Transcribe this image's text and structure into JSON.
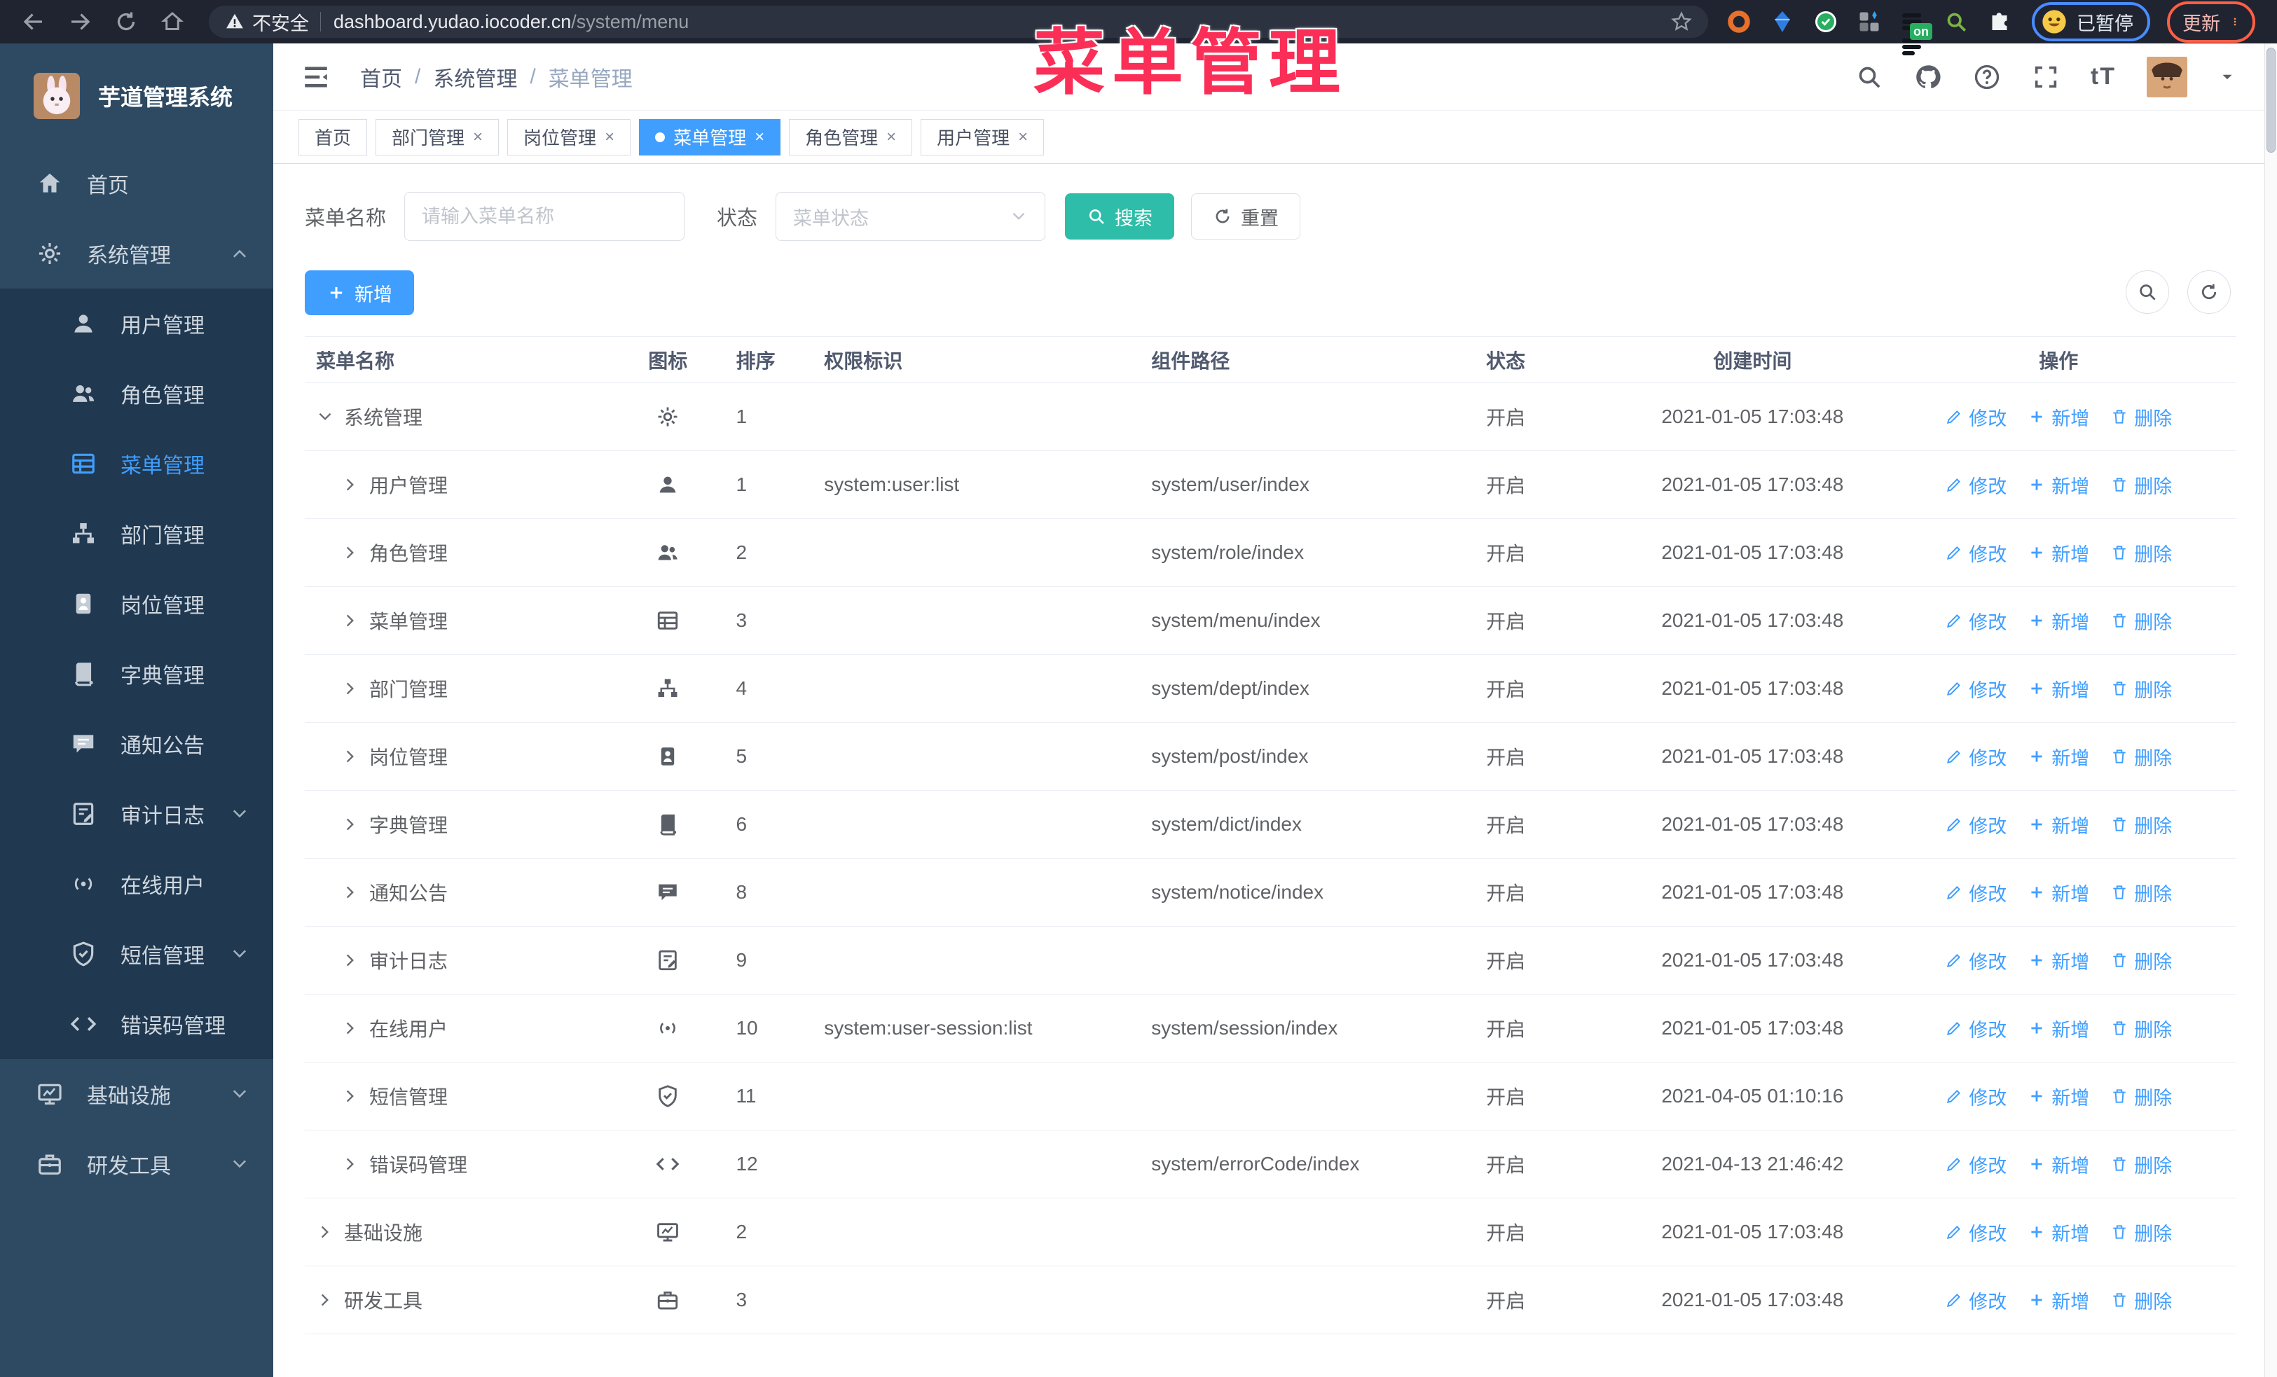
{
  "colors": {
    "accent": "#409eff",
    "search_btn": "#2dbda8",
    "annotation": "#fb2e57",
    "sidebar_bg": "#2e4a63",
    "submenu_bg": "#203850",
    "chrome_bg": "#1f2430"
  },
  "annotation": {
    "title": "菜单管理"
  },
  "browser": {
    "security_label": "不安全",
    "url_host": "dashboard.yudao.iocoder.cn",
    "url_path": "/system/menu",
    "extension_badge": "on",
    "paused_label": "已暂停",
    "update_label": "更新"
  },
  "app": {
    "title": "芋道管理系统"
  },
  "breadcrumb": {
    "items": [
      "首页",
      "系统管理",
      "菜单管理"
    ],
    "separator": "/"
  },
  "header_icons": {
    "text_size": "tT"
  },
  "tabs": [
    {
      "label": "首页",
      "closable": false,
      "active": false
    },
    {
      "label": "部门管理",
      "closable": true,
      "active": false
    },
    {
      "label": "岗位管理",
      "closable": true,
      "active": false
    },
    {
      "label": "菜单管理",
      "closable": true,
      "active": true
    },
    {
      "label": "角色管理",
      "closable": true,
      "active": false
    },
    {
      "label": "用户管理",
      "closable": true,
      "active": false
    }
  ],
  "sidebar": {
    "items": [
      {
        "label": "首页",
        "icon": "home"
      },
      {
        "label": "系统管理",
        "icon": "gear",
        "chevron": "up",
        "open": true,
        "children": [
          {
            "label": "用户管理",
            "icon": "user"
          },
          {
            "label": "角色管理",
            "icon": "users"
          },
          {
            "label": "菜单管理",
            "icon": "menu",
            "active": true
          },
          {
            "label": "部门管理",
            "icon": "tree"
          },
          {
            "label": "岗位管理",
            "icon": "post"
          },
          {
            "label": "字典管理",
            "icon": "dict"
          },
          {
            "label": "通知公告",
            "icon": "notice"
          },
          {
            "label": "审计日志",
            "icon": "log",
            "chevron": "down"
          },
          {
            "label": "在线用户",
            "icon": "online"
          },
          {
            "label": "短信管理",
            "icon": "shield",
            "chevron": "down"
          },
          {
            "label": "错误码管理",
            "icon": "code"
          }
        ]
      },
      {
        "label": "基础设施",
        "icon": "monitor",
        "chevron": "down"
      },
      {
        "label": "研发工具",
        "icon": "tool",
        "chevron": "down"
      }
    ]
  },
  "filters": {
    "name_label": "菜单名称",
    "name_placeholder": "请输入菜单名称",
    "status_label": "状态",
    "status_placeholder": "菜单状态",
    "search_label": "搜索",
    "reset_label": "重置"
  },
  "toolbar": {
    "add_label": "新增"
  },
  "table": {
    "columns": [
      "菜单名称",
      "图标",
      "排序",
      "权限标识",
      "组件路径",
      "状态",
      "创建时间",
      "操作"
    ],
    "actions": [
      {
        "label": "修改",
        "icon": "edit"
      },
      {
        "label": "新增",
        "icon": "plus"
      },
      {
        "label": "删除",
        "icon": "trash"
      }
    ],
    "rows": [
      {
        "name": "系统管理",
        "icon": "gear",
        "level": 0,
        "expanded": true,
        "order": "1",
        "perm": "",
        "path": "",
        "status": "开启",
        "time": "2021-01-05 17:03:48"
      },
      {
        "name": "用户管理",
        "icon": "user",
        "level": 1,
        "expanded": false,
        "order": "1",
        "perm": "system:user:list",
        "path": "system/user/index",
        "status": "开启",
        "time": "2021-01-05 17:03:48"
      },
      {
        "name": "角色管理",
        "icon": "users",
        "level": 1,
        "expanded": false,
        "order": "2",
        "perm": "",
        "path": "system/role/index",
        "status": "开启",
        "time": "2021-01-05 17:03:48"
      },
      {
        "name": "菜单管理",
        "icon": "menu",
        "level": 1,
        "expanded": false,
        "order": "3",
        "perm": "",
        "path": "system/menu/index",
        "status": "开启",
        "time": "2021-01-05 17:03:48"
      },
      {
        "name": "部门管理",
        "icon": "tree",
        "level": 1,
        "expanded": false,
        "order": "4",
        "perm": "",
        "path": "system/dept/index",
        "status": "开启",
        "time": "2021-01-05 17:03:48"
      },
      {
        "name": "岗位管理",
        "icon": "post",
        "level": 1,
        "expanded": false,
        "order": "5",
        "perm": "",
        "path": "system/post/index",
        "status": "开启",
        "time": "2021-01-05 17:03:48"
      },
      {
        "name": "字典管理",
        "icon": "dict",
        "level": 1,
        "expanded": false,
        "order": "6",
        "perm": "",
        "path": "system/dict/index",
        "status": "开启",
        "time": "2021-01-05 17:03:48"
      },
      {
        "name": "通知公告",
        "icon": "notice",
        "level": 1,
        "expanded": false,
        "order": "8",
        "perm": "",
        "path": "system/notice/index",
        "status": "开启",
        "time": "2021-01-05 17:03:48"
      },
      {
        "name": "审计日志",
        "icon": "log",
        "level": 1,
        "expanded": false,
        "order": "9",
        "perm": "",
        "path": "",
        "status": "开启",
        "time": "2021-01-05 17:03:48"
      },
      {
        "name": "在线用户",
        "icon": "online",
        "level": 1,
        "expanded": false,
        "order": "10",
        "perm": "system:user-session:list",
        "path": "system/session/index",
        "status": "开启",
        "time": "2021-01-05 17:03:48"
      },
      {
        "name": "短信管理",
        "icon": "shield",
        "level": 1,
        "expanded": false,
        "order": "11",
        "perm": "",
        "path": "",
        "status": "开启",
        "time": "2021-04-05 01:10:16"
      },
      {
        "name": "错误码管理",
        "icon": "code",
        "level": 1,
        "expanded": false,
        "order": "12",
        "perm": "",
        "path": "system/errorCode/index",
        "status": "开启",
        "time": "2021-04-13 21:46:42"
      },
      {
        "name": "基础设施",
        "icon": "monitor",
        "level": 0,
        "expanded": false,
        "order": "2",
        "perm": "",
        "path": "",
        "status": "开启",
        "time": "2021-01-05 17:03:48"
      },
      {
        "name": "研发工具",
        "icon": "tool",
        "level": 0,
        "expanded": false,
        "order": "3",
        "perm": "",
        "path": "",
        "status": "开启",
        "time": "2021-01-05 17:03:48"
      }
    ]
  }
}
